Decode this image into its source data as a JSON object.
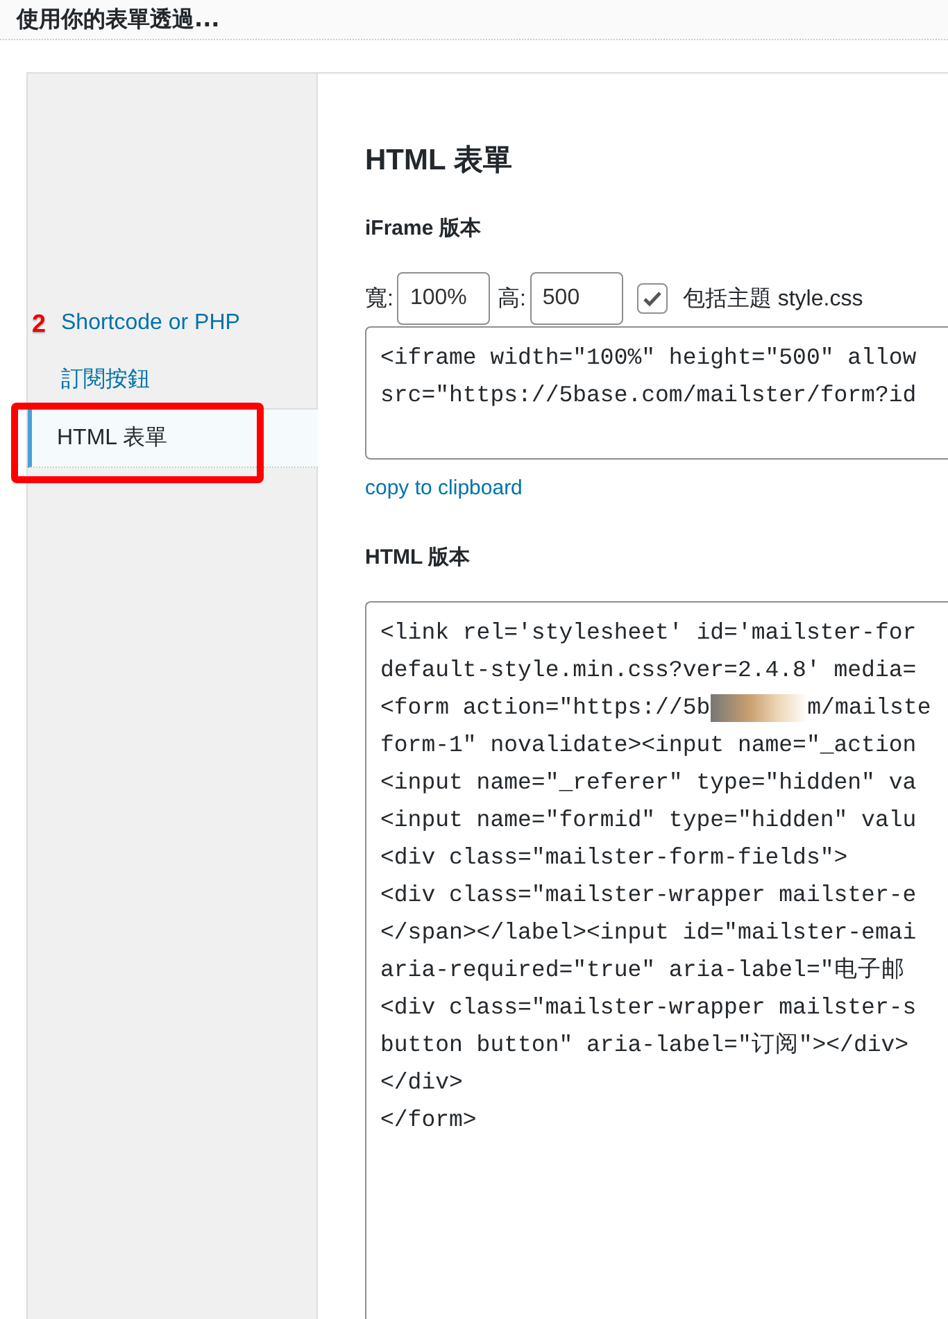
{
  "header": {
    "title": "使用你的表單透過..."
  },
  "sidebar": {
    "items": [
      {
        "label": "Shortcode or PHP",
        "selected": false
      },
      {
        "label": "訂閱按鈕",
        "selected": false
      },
      {
        "label": "HTML 表單",
        "selected": true
      }
    ]
  },
  "annotation": {
    "badge": "2"
  },
  "content": {
    "title": "HTML 表單",
    "iframe_section": {
      "heading": "iFrame 版本",
      "width_label": "寬:",
      "width_value": "100%",
      "height_label": "高:",
      "height_value": "500",
      "include_theme_style": {
        "label": "包括主題 style.css",
        "checked": true
      },
      "code_lines": [
        {
          "text": "<iframe width=\"100%\" height=\"500\" allow"
        },
        {
          "text": "src=\"https://5base.com/mailster/form?id"
        }
      ],
      "copy_link": "copy to clipboard"
    },
    "html_section": {
      "heading": "HTML 版本",
      "code_lines": [
        {
          "text": "<link rel='stylesheet' id='mailster-for"
        },
        {
          "text": "default-style.min.css?ver=2.4.8' media="
        },
        {
          "text": "<form action=\"https://5b",
          "after_redaction": "m/mailste"
        },
        {
          "text": "form-1\" novalidate><input name=\"_action"
        },
        {
          "text": "<input name=\"_referer\" type=\"hidden\" va"
        },
        {
          "text": "<input name=\"formid\" type=\"hidden\" valu"
        },
        {
          "text": "<div class=\"mailster-form-fields\">"
        },
        {
          "text": "<div class=\"mailster-wrapper mailster-e"
        },
        {
          "text": "</span></label><input id=\"mailster-emai"
        },
        {
          "text": "aria-required=\"true\" aria-label=\"电子邮"
        },
        {
          "text": "<div class=\"mailster-wrapper mailster-s"
        },
        {
          "text": "button button\" aria-label=\"订阅\"></div>"
        },
        {
          "text": "</div>"
        },
        {
          "text": "</form>"
        }
      ]
    }
  }
}
